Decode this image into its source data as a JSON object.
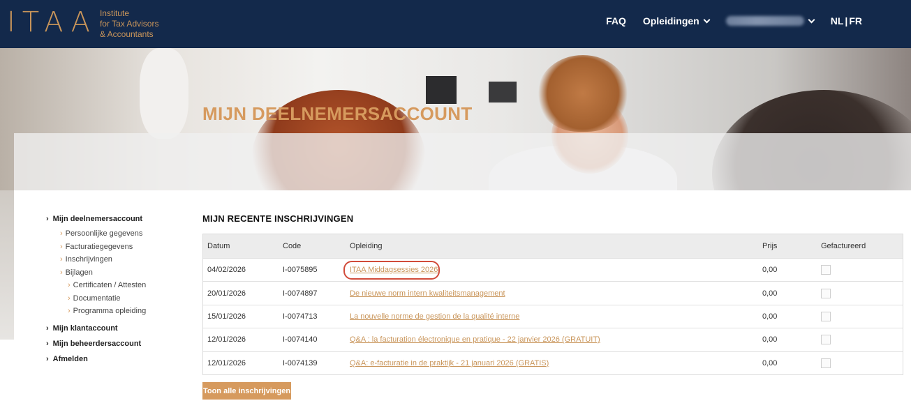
{
  "header": {
    "logo_mark": "ITAA",
    "logo_line1": "Institute",
    "logo_line2": "for Tax Advisors",
    "logo_line3": "& Accountants",
    "nav": {
      "faq": "FAQ",
      "opleidingen": "Opleidingen",
      "lang_nl": "NL",
      "lang_sep": "|",
      "lang_fr": "FR"
    }
  },
  "hero": {
    "title": "MIJN DEELNEMERSACCOUNT"
  },
  "sidebar": {
    "account": "Mijn deelnemersaccount",
    "sub": [
      "Persoonlijke gegevens",
      "Facturatiegegevens",
      "Inschrijvingen",
      "Bijlagen"
    ],
    "bijlagen_sub": [
      "Certificaten / Attesten",
      "Documentatie",
      "Programma opleiding"
    ],
    "klant": "Mijn klantaccount",
    "beheerder": "Mijn beheerdersaccount",
    "afmelden": "Afmelden"
  },
  "main": {
    "section_title": "MIJN RECENTE INSCHRIJVINGEN",
    "columns": [
      "Datum",
      "Code",
      "Opleiding",
      "Prijs",
      "Gefactureerd"
    ],
    "rows": [
      {
        "date": "04/02/2026",
        "code": "I-0075895",
        "opleiding": "ITAA Middagsessies 2026",
        "prijs": "0,00"
      },
      {
        "date": "20/01/2026",
        "code": "I-0074897",
        "opleiding": "De nieuwe norm intern kwaliteitsmanagement",
        "prijs": "0,00"
      },
      {
        "date": "15/01/2026",
        "code": "I-0074713",
        "opleiding": "La nouvelle norme de gestion de la qualité interne",
        "prijs": "0,00"
      },
      {
        "date": "12/01/2026",
        "code": "I-0074140",
        "opleiding": "Q&A : la facturation électronique en pratique - 22 janvier 2026 (GRATUIT)",
        "prijs": "0,00"
      },
      {
        "date": "12/01/2026",
        "code": "I-0074139",
        "opleiding": "Q&A: e-facturatie in de praktijk - 21 januari 2026 (GRATIS)",
        "prijs": "0,00"
      }
    ],
    "button": "Toon alle inschrijvingen"
  },
  "colors": {
    "navy": "#13294b",
    "accent": "#d69a5e",
    "highlight": "#d14b3a"
  }
}
